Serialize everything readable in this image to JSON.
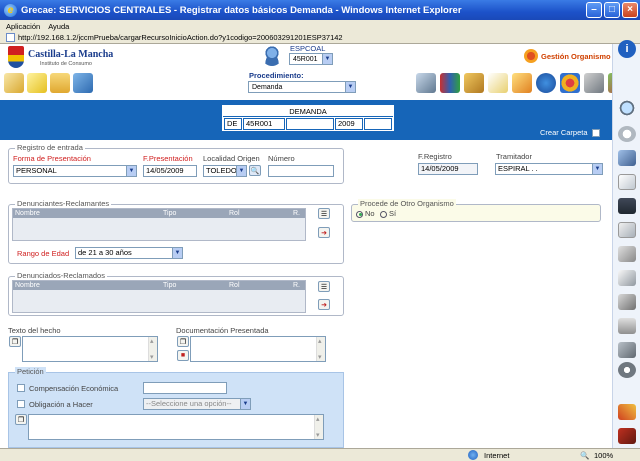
{
  "window": {
    "title": "Grecae: SERVICIOS CENTRALES - Registrar datos básicos Demanda - Windows Internet Explorer",
    "url": "http://192.168.1.2/jccmPrueba/cargarRecursoInicioAction.do?y1codigo=200603291201ESP37142"
  },
  "menu": {
    "items": [
      "Aplicación",
      "Ayuda"
    ]
  },
  "header": {
    "logo_title": "Castilla-La Mancha",
    "logo_subtitle": "Instituto de Consumo",
    "espcoal_label": "ESPCOAL",
    "espcoal_value": "45R001",
    "gestion_label": "Gestión Organismo",
    "procedimiento_label": "Procedimiento:",
    "procedimiento_value": "Demanda"
  },
  "banner": {
    "title": "DEMANDA",
    "fields": [
      "DE",
      "45R001",
      "",
      "2009",
      ""
    ],
    "crear_carpeta": "Crear Carpeta"
  },
  "registro": {
    "legend": "Registro de entrada",
    "forma_label": "Forma de Presentación",
    "forma_value": "PERSONAL",
    "fpres_label": "F.Presentación",
    "fpres_value": "14/05/2009",
    "localidad_label": "Localidad Origen",
    "localidad_value": "TOLEDO",
    "numero_label": "Número",
    "numero_value": ""
  },
  "fregistro": {
    "label": "F.Registro",
    "value": "14/05/2009"
  },
  "tramitador": {
    "label": "Tramitador",
    "value": "ESPIRAL . ."
  },
  "denunciantes": {
    "legend": "Denunciantes-Reclamantes",
    "columns": [
      "Nombre",
      "Tipo",
      "Rol",
      "R."
    ],
    "rango_label": "Rango de Edad",
    "rango_value": "de 21 a 30 años"
  },
  "otro_organismo": {
    "legend": "Procede de Otro Organismo",
    "options": [
      "No",
      "Sí"
    ],
    "selected": "No"
  },
  "denunciados": {
    "legend": "Denunciados-Reclamados",
    "columns": [
      "Nombre",
      "Tipo",
      "Rol",
      "R."
    ]
  },
  "texto_hecho": {
    "label": "Texto del hecho"
  },
  "documentacion": {
    "label": "Documentación Presentada"
  },
  "peticion": {
    "legend": "Petición",
    "compensacion_label": "Compensación Económica",
    "obligacion_label": "Obligación a Hacer",
    "obligacion_placeholder": "--Seleccione una opción--"
  },
  "status": {
    "zone": "Internet",
    "zoom": "100%"
  }
}
